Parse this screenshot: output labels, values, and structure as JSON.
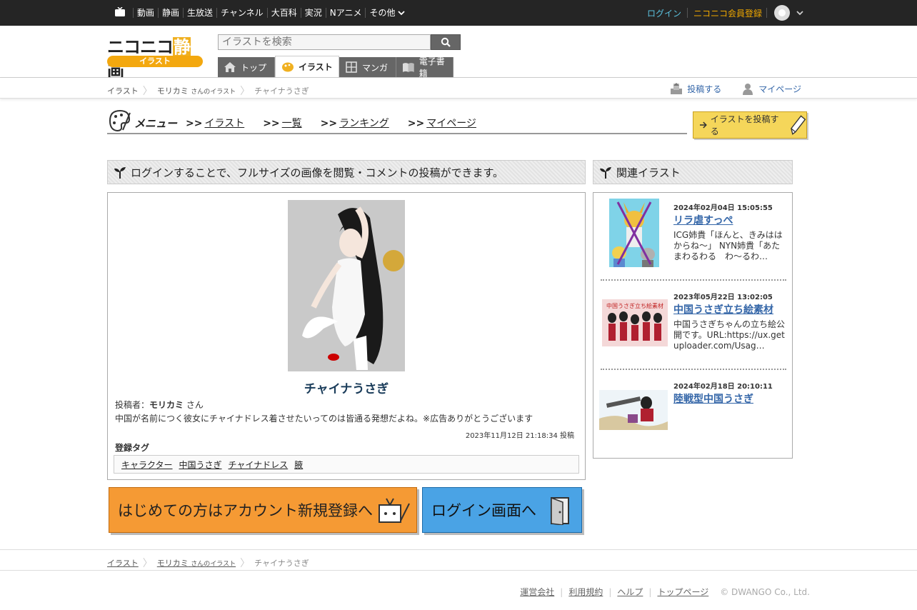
{
  "topbar": {
    "nav": [
      "動画",
      "静画",
      "生放送",
      "チャンネル",
      "大百科",
      "実況",
      "Nアニメ"
    ],
    "more_label": "その他",
    "login": "ログイン",
    "register": "ニコニコ会員登録"
  },
  "header": {
    "logo_main_a": "ニコニコ",
    "logo_main_b": "静",
    "logo_main_c": "画",
    "logo_sub": "イラスト",
    "search_placeholder": "イラストを検索",
    "tabs": [
      {
        "label": "トップ",
        "icon": "home-icon"
      },
      {
        "label": "イラスト",
        "icon": "palette-icon"
      },
      {
        "label": "マンガ",
        "icon": "manga-icon"
      },
      {
        "label": "電子書籍",
        "icon": "book-icon"
      }
    ]
  },
  "breadcrumb": {
    "root": "イラスト",
    "user": "モリカミ",
    "user_suffix": "さんのイラスト",
    "current": "チャイナうさぎ",
    "actions": {
      "post": "投稿する",
      "mypage": "マイページ"
    }
  },
  "menu": {
    "title": "メニュー",
    "links": [
      "イラスト",
      "一覧",
      "ランキング",
      "マイページ"
    ],
    "arrow": ">>",
    "post_button": "イラストを投稿する"
  },
  "main": {
    "header": "ログインすることで、フルサイズの画像を閲覧・コメントの投稿ができます。",
    "title": "チャイナうさぎ",
    "poster_label": "投稿者：",
    "poster_name": "モリカミ",
    "poster_suffix": "さん",
    "description": "中国が名前につく彼女にチャイナドレス着させたいってのは皆通る発想だよね。※広告ありがとうございます",
    "posted_at": "2023年11月12日 21:18:34 投稿",
    "tags_label": "登録タグ",
    "tags": [
      "キャラクター",
      "中国うさぎ",
      "チャイナドレス",
      "腋"
    ]
  },
  "buttons": {
    "register": "はじめての方はアカウント新規登録へ",
    "login": "ログイン画面へ"
  },
  "related": {
    "header": "関連イラスト",
    "items": [
      {
        "date": "2024年02月04日 15:05:55",
        "title": "リラ虐すっぺ",
        "desc": "ICG姉貴「ほんと、きみははからね〜」 NYN姉貴「あたまわるわる　わ〜るわ…"
      },
      {
        "date": "2023年05月22日 13:02:05",
        "title": "中国うさぎ立ち絵素材",
        "desc": "中国うさぎちゃんの立ち絵公開です。URL:https://ux.getuploader.com/Usag…"
      },
      {
        "date": "2024年02月18日 20:10:11",
        "title": "陸戦型中国うさぎ",
        "desc": ""
      }
    ]
  },
  "footer": {
    "links": [
      "運営会社",
      "利用規約",
      "ヘルプ",
      "トップページ"
    ],
    "copyright": "© DWANGO Co., Ltd."
  },
  "colors": {
    "topbar": "#252525",
    "login_link": "#5cc3e0",
    "register_link": "#f0a800",
    "link_blue": "#3466a8",
    "register_button": "#f59a34",
    "login_button": "#4aa3e5"
  }
}
